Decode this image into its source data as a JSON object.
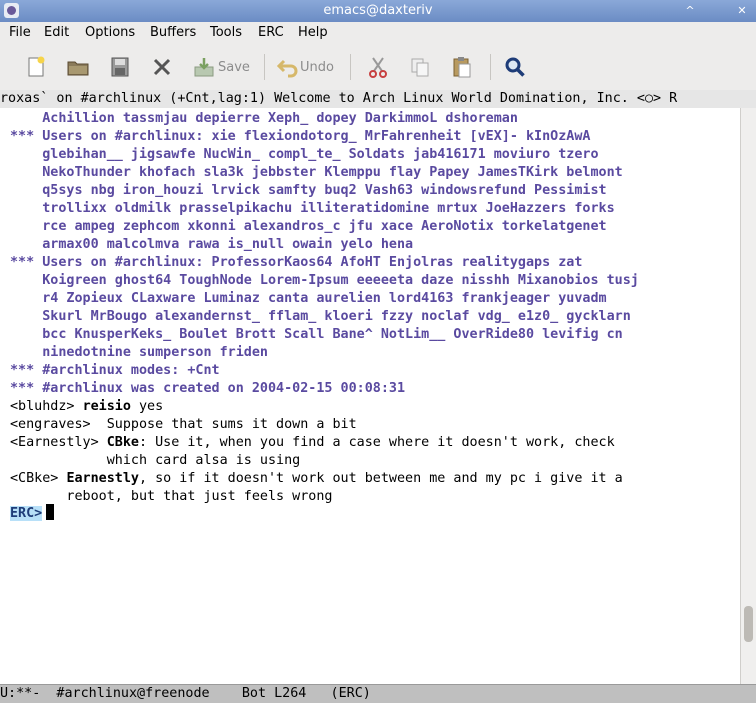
{
  "window": {
    "title": "emacs@daxteriv",
    "controls": [
      "^",
      "✕"
    ]
  },
  "menu": [
    "File",
    "Edit",
    "Options",
    "Buffers",
    "Tools",
    "ERC",
    "Help"
  ],
  "toolbar": {
    "save_label": "Save",
    "undo_label": "Undo",
    "icons": [
      "new-file-icon",
      "open-folder-icon",
      "save-disk-icon",
      "close-x-icon",
      "save-icon",
      "undo-icon",
      "cut-icon",
      "copy-icon",
      "paste-icon",
      "search-icon"
    ]
  },
  "header_line": "roxas` on #archlinux (+Cnt,lag:1) Welcome to Arch Linux World Domination, Inc. <○> R",
  "buffer": {
    "lines": [
      {
        "kind": "notice",
        "text": "    Achillion tassmjau depierre Xeph_ dopey DarkimmoL dshoreman"
      },
      {
        "kind": "notice",
        "text": "*** Users on #archlinux: xie flexiondotorg_ MrFahrenheit [vEX]- kInOzAwA"
      },
      {
        "kind": "notice",
        "text": "    glebihan__ jigsawfe NucWin_ compl_te_ Soldats jab416171 moviuro tzero"
      },
      {
        "kind": "notice",
        "text": "    NekoThunder khofach sla3k jebbster Klemppu flay Papey JamesTKirk belmont"
      },
      {
        "kind": "notice",
        "text": "    q5sys nbg iron_houzi lrvick samfty buq2 Vash63 windowsrefund Pessimist"
      },
      {
        "kind": "notice",
        "text": "    trollixx oldmilk prasselpikachu illiteratidomine mrtux JoeHazzers forks"
      },
      {
        "kind": "notice",
        "text": "    rce ampeg zephcom xkonni alexandros_c jfu xace AeroNotix torkelatgenet"
      },
      {
        "kind": "notice",
        "text": "    armax00 malcolmva rawa is_null owain yelo hena"
      },
      {
        "kind": "notice",
        "text": "*** Users on #archlinux: ProfessorKaos64 AfoHT Enjolras realitygaps zat"
      },
      {
        "kind": "notice",
        "text": "    Koigreen ghost64 ToughNode Lorem-Ipsum eeeeeta daze nisshh Mixanobios tusj"
      },
      {
        "kind": "notice",
        "text": "    r4 Zopieux CLaxware Luminaz canta aurelien lord4163 frankjeager yuvadm"
      },
      {
        "kind": "notice",
        "text": "    Skurl MrBougo alexandernst_ fflam_ kloeri fzzy noclaf vdg_ e1z0_ gycklarn"
      },
      {
        "kind": "notice",
        "text": "    bcc KnusperKeks_ Boulet Brott Scall Bane^ NotLim__ OverRide80 levifig cn"
      },
      {
        "kind": "notice",
        "text": "    ninedotnine sumperson friden"
      },
      {
        "kind": "notice",
        "text": "*** #archlinux modes: +Cnt"
      },
      {
        "kind": "notice",
        "text": "*** #archlinux was created on 2004-02-15 00:08:31"
      },
      {
        "kind": "chat",
        "nick": "<bluhdz>",
        "addressee": "reisio",
        "text": " yes"
      },
      {
        "kind": "chat",
        "nick": "<engraves>",
        "addressee": "",
        "text": " Suppose that sums it down a bit"
      },
      {
        "kind": "chat",
        "nick": "<Earnestly>",
        "addressee": "CBke",
        "text": ": Use it, when you find a case where it doesn't work, check"
      },
      {
        "kind": "cont",
        "text": "            which card alsa is using"
      },
      {
        "kind": "chat",
        "nick": "<CBke>",
        "addressee": "Earnestly",
        "text": ", so if it doesn't work out between me and my pc i give it a"
      },
      {
        "kind": "cont",
        "text": "       reboot, but that just feels wrong"
      }
    ],
    "prompt": "ERC>"
  },
  "mode_line": "U:**-  #archlinux@freenode    Bot L264   (ERC)"
}
